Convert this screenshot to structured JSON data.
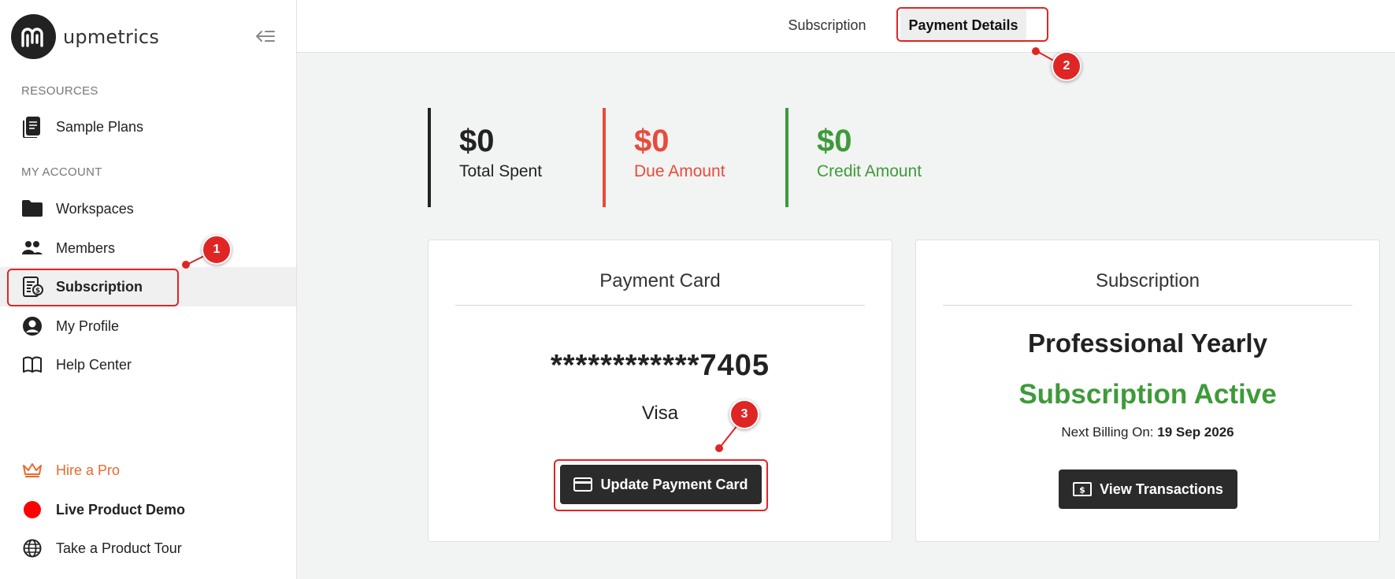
{
  "app": {
    "name": "upmetrics"
  },
  "sidebar": {
    "resources_title": "RESOURCES",
    "resources": [
      {
        "label": "Sample Plans",
        "icon": "document-icon"
      }
    ],
    "account_title": "MY ACCOUNT",
    "account": [
      {
        "label": "Workspaces",
        "icon": "folder-icon"
      },
      {
        "label": "Members",
        "icon": "people-icon"
      },
      {
        "label": "Subscription",
        "icon": "subscription-icon",
        "active": true
      },
      {
        "label": "My Profile",
        "icon": "profile-icon"
      },
      {
        "label": "Help Center",
        "icon": "book-icon"
      }
    ],
    "bottom": [
      {
        "label": "Hire a Pro",
        "icon": "crown-icon",
        "color": "#e9692c"
      },
      {
        "label": "Live Product Demo",
        "icon": "live-dot-icon",
        "color": "#ff0000"
      },
      {
        "label": "Take a Product Tour",
        "icon": "globe-icon"
      }
    ]
  },
  "tabs": [
    {
      "label": "Subscription",
      "active": false
    },
    {
      "label": "Payment Details",
      "active": true
    }
  ],
  "stats": [
    {
      "amount": "$0",
      "label": "Total Spent",
      "color": "#222222"
    },
    {
      "amount": "$0",
      "label": "Due Amount",
      "color": "#e74c3c"
    },
    {
      "amount": "$0",
      "label": "Credit Amount",
      "color": "#3e9a3a"
    }
  ],
  "payment_card": {
    "title": "Payment Card",
    "masked_number": "************7405",
    "brand": "Visa",
    "button": "Update Payment Card"
  },
  "subscription_card": {
    "title": "Subscription",
    "plan": "Professional Yearly",
    "status": "Subscription Active",
    "next_billing_label": "Next Billing On:",
    "next_billing_date": "19 Sep 2026",
    "button": "View Transactions"
  },
  "annotations": {
    "step1": "1",
    "step2": "2",
    "step3": "3"
  }
}
